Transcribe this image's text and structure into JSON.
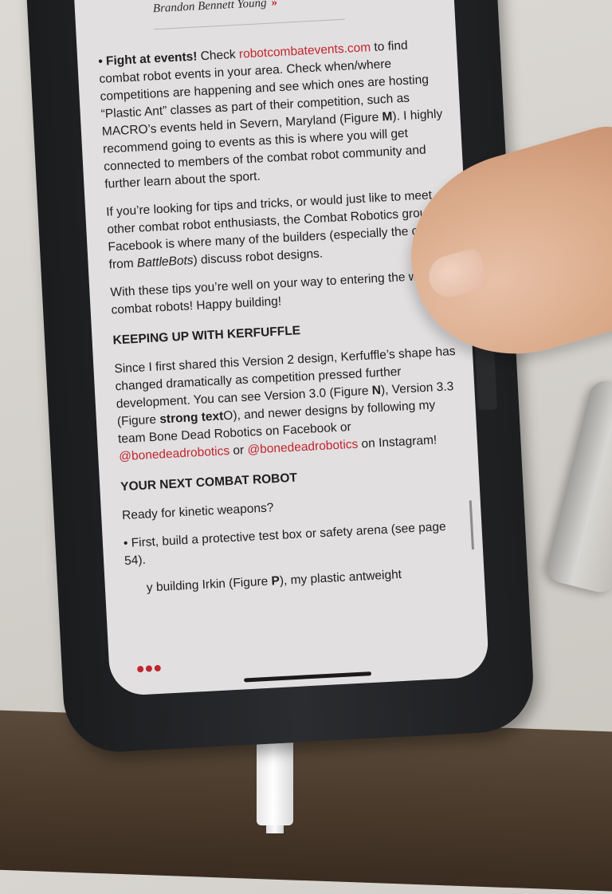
{
  "article": {
    "byline": "Brandon Bennett Young",
    "byline_chevron": "»",
    "p1_bullet": "• ",
    "p1_bold": "Fight at events!",
    "p1_a": " Check ",
    "p1_link": "robotcombatevents.com",
    "p1_b": " to find combat robot events in your area. Check when/where competitions are happening and see which ones are hosting “Plastic Ant” classes as part of their competition, such as MACRO’s events held in Severn, Maryland (Figure ",
    "p1_fig": "M",
    "p1_c": "). I highly recommend going to events as this is where you will get connected to members of the combat robot community and further learn about the sport.",
    "p2_a": "If you’re looking for tips and tricks, or would just like to meet other combat robot enthusiasts, the Combat Robotics group on Facebook is where many of the builders (especially the ones from ",
    "p2_italic": "BattleBots",
    "p2_b": ") discuss robot designs.",
    "p3": "With these tips you’re well on your way to entering the world of combat robots! Happy building!",
    "h1": "KEEPING UP WITH KERFUFFLE",
    "p4_a": "Since I first shared this Version 2 design, Kerfuffle’s shape has changed dramatically as competition pressed further development. You can see Version 3.0 (Figure ",
    "p4_fig1": "N",
    "p4_b": "), Version 3.3 (Figure ",
    "p4_fig2": "strong text",
    "p4_c": "O), and newer designs by following my team Bone Dead Robotics on Facebook or ",
    "p4_link1": "@bonedeadrobotics",
    "p4_d": " or ",
    "p4_link2": "@bonedeadrobotics",
    "p4_e": " on Instagram!",
    "h2": "YOUR NEXT COMBAT ROBOT",
    "p5": "Ready for kinetic weapons?",
    "p6": "• First, build a protective test box or safety arena (see page 54).",
    "p7_a": "y building Irkin (Figure ",
    "p7_fig": "P",
    "p7_b": "), my plastic antweight"
  },
  "ui": {
    "menu_dots": "•••"
  },
  "colors": {
    "link": "#c0262d",
    "screen_bg": "#e2dfe1",
    "case": "#2b2c2f"
  }
}
